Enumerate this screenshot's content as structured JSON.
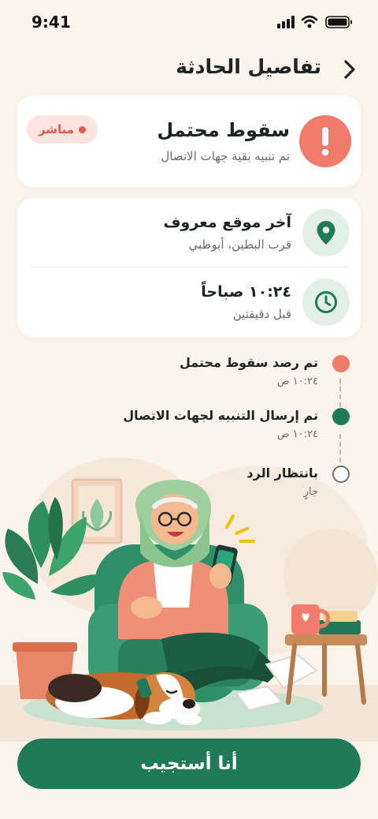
{
  "status_bar": {
    "time": "9:41",
    "icons": [
      "signal-icon",
      "wifi-icon",
      "battery-icon"
    ]
  },
  "header": {
    "title": "تفاصيل الحادثة",
    "back_icon": "chevron-right-icon"
  },
  "alert_card": {
    "title": "سقوط محتمل",
    "subtitle": "تم تنبيه بقية جهات الاتصال",
    "badge": "مباشر",
    "icon": "exclamation-icon"
  },
  "info_card": {
    "location": {
      "title": "آخر موقع معروف",
      "subtitle": "قرب البطين، أبوظبي",
      "icon": "location-pin-icon"
    },
    "time": {
      "title": "١٠:٢٤ صباحاً",
      "subtitle": "قبل دقيقتين",
      "icon": "clock-icon"
    }
  },
  "timeline": [
    {
      "title": "تم رصد سقوط محتمل",
      "time": "١٠:٢٤ ص",
      "state": "alert"
    },
    {
      "title": "تم إرسال التنبيه لجهات الاتصال",
      "time": "١٠:٢٤ ص",
      "state": "done"
    },
    {
      "title": "بانتظار الرد",
      "time": "جارٍ",
      "state": "pending"
    }
  ],
  "cta": {
    "label": "أنا أستجيب"
  },
  "colors": {
    "background": "#fbf4ec",
    "accent_green": "#1f7a5a",
    "alert_coral": "#f07b6a",
    "badge_bg": "#fde4df",
    "icon_bg": "#e3f0e8"
  }
}
